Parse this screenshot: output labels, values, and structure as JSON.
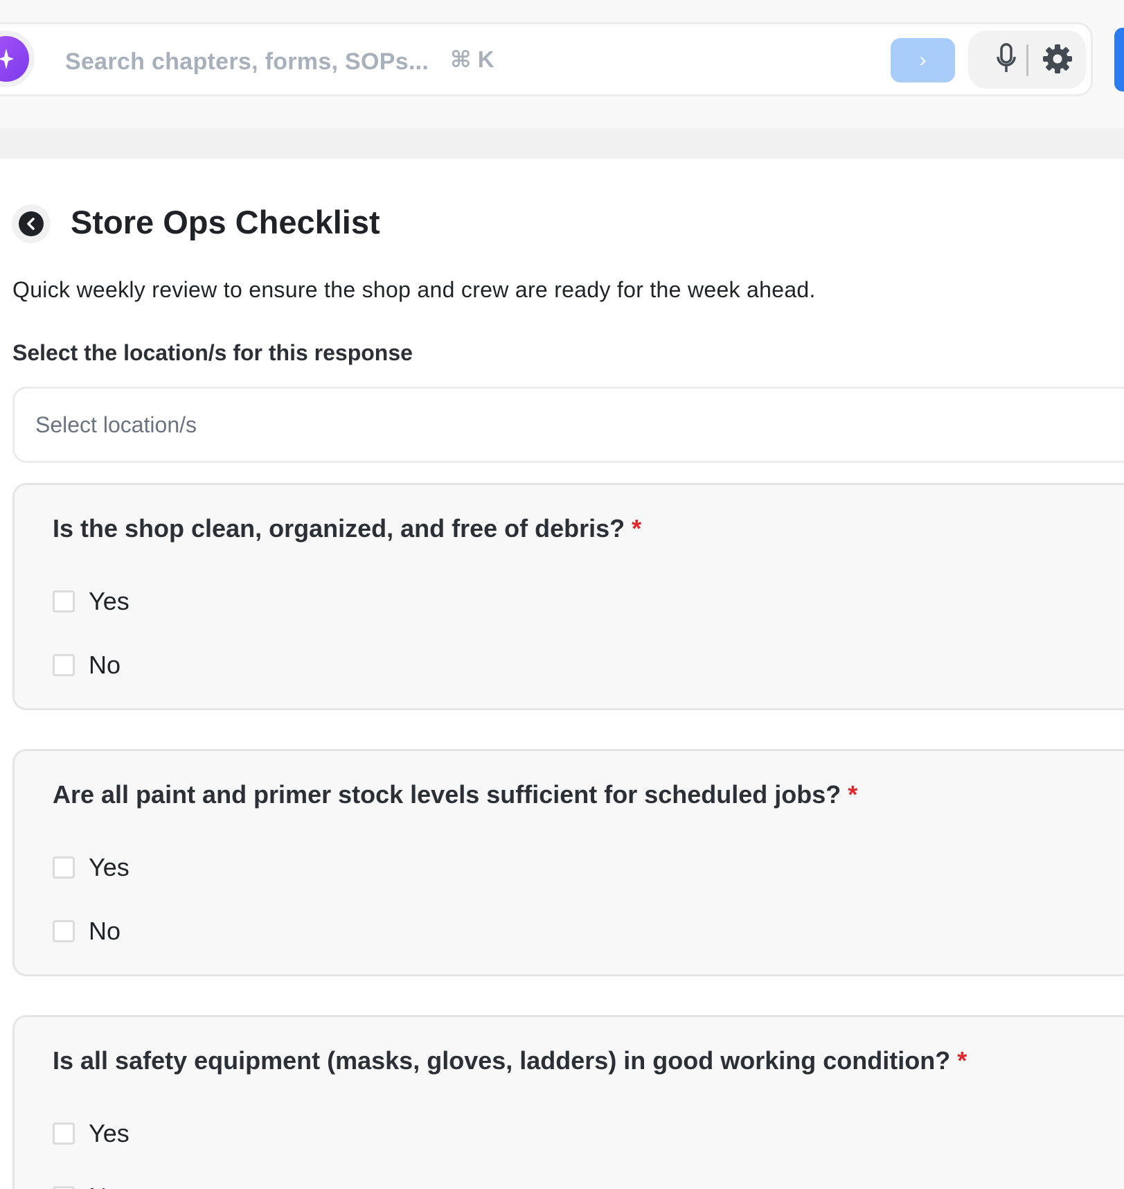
{
  "search": {
    "placeholder": "Search chapters, forms, SOPs...",
    "shortcut": "⌘ K",
    "submit_glyph": "›"
  },
  "icons": {
    "ai": "sparkle-icon",
    "submit": "chevron-right-icon",
    "mic": "microphone-icon",
    "settings": "gear-icon",
    "back": "chevron-left-icon"
  },
  "colors": {
    "ai_gradient_start": "#a855f7",
    "ai_gradient_end": "#7c3aed",
    "submit_bg": "#a9cdfb",
    "edge_button": "#2b7cf0",
    "required": "#e3262b"
  },
  "header": {
    "title": "Store Ops Checklist",
    "description": "Quick weekly review to ensure the shop and crew are ready for the week ahead."
  },
  "location": {
    "label": "Select the location/s for this response",
    "placeholder": "Select location/s"
  },
  "questions": [
    {
      "text": "Is the shop clean, organized, and free of debris?",
      "required_mark": "*",
      "options": [
        "Yes",
        "No"
      ]
    },
    {
      "text": "Are all paint and primer stock levels sufficient for scheduled jobs?",
      "required_mark": "*",
      "options": [
        "Yes",
        "No"
      ]
    },
    {
      "text": "Is all safety equipment (masks, gloves, ladders) in good working condition?",
      "required_mark": "*",
      "options": [
        "Yes",
        "No"
      ]
    }
  ]
}
